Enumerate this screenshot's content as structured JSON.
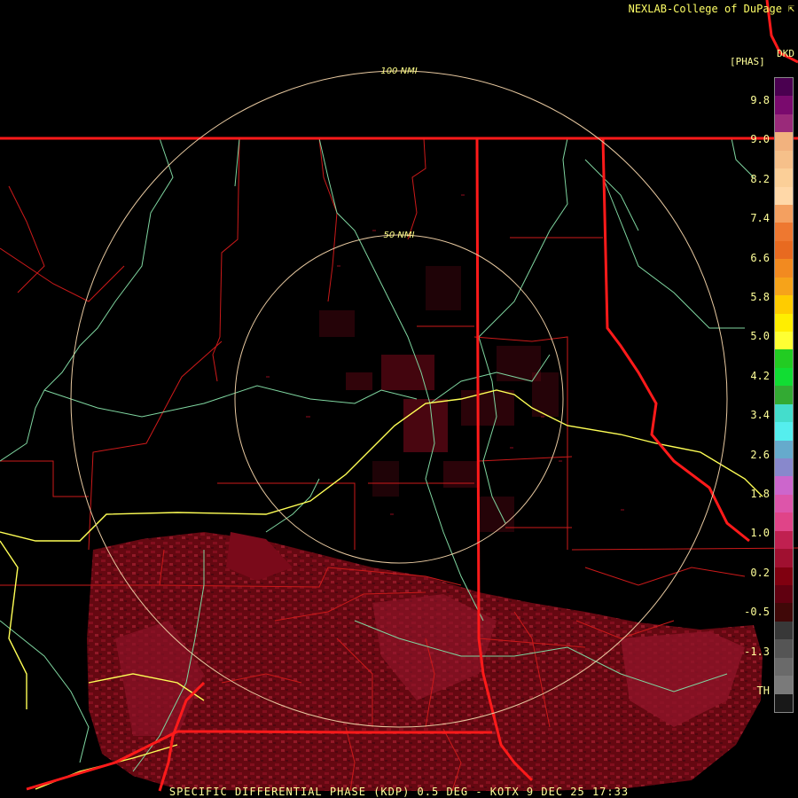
{
  "header": {
    "credit": "NEXLAB-College of DuPage",
    "credit_icon": "arrow-corner-icon",
    "product_code": "DKD",
    "units": "[PHAS]"
  },
  "range_rings": [
    {
      "label": "100 NMI",
      "radius_nmi": 100
    },
    {
      "label": "50 NMI",
      "radius_nmi": 50
    }
  ],
  "legend": {
    "tick_labels": [
      "9.8",
      "9.0",
      "8.2",
      "7.4",
      "6.6",
      "5.8",
      "5.0",
      "4.2",
      "3.4",
      "2.6",
      "1.8",
      "1.0",
      "0.2",
      "-0.5",
      "-1.3",
      "TH"
    ],
    "colors": [
      "#4a0050",
      "#7a0a6e",
      "#9a2a7a",
      "#f2b27e",
      "#f6c08a",
      "#fbcf98",
      "#ffd8a8",
      "#f4a060",
      "#ee7830",
      "#e86a20",
      "#f28a20",
      "#f6a31a",
      "#ffcc00",
      "#ffee00",
      "#ffff33",
      "#22cc22",
      "#11dd33",
      "#33aa33",
      "#44ddcc",
      "#55eeee",
      "#66aacc",
      "#8888cc",
      "#cc66cc",
      "#dd55aa",
      "#e04488",
      "#c02050",
      "#a01030",
      "#800010",
      "#600010",
      "#400808",
      "#383838",
      "#555555",
      "#6a6a6a",
      "#7a7a7a",
      "#181818"
    ]
  },
  "colors": {
    "state_border": "#ff1a1a",
    "county_lines": "#cc1a1a",
    "rivers": "#7fd6a0",
    "highway": "#ffff55",
    "range_ring": "#e8c9a0",
    "echo": "#7a0a1a"
  },
  "footer": "SPECIFIC DIFFERENTIAL PHASE (KDP) 0.5 DEG - KOTX 9 DEC 25 17:33"
}
